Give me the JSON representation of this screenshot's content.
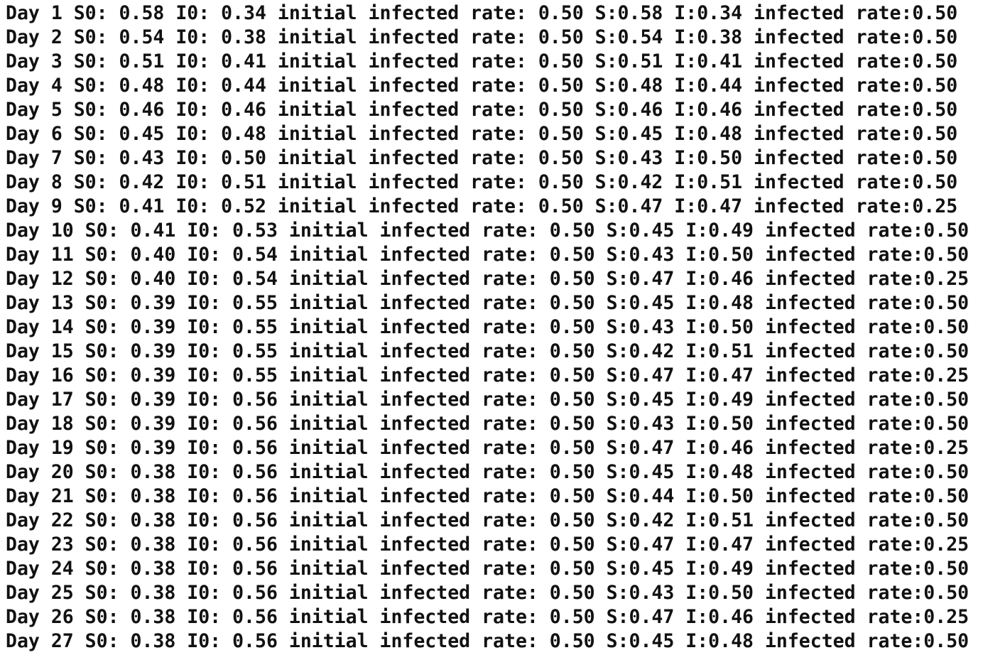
{
  "terminal": {
    "lines": [
      "Day 1 S0: 0.58 I0: 0.34 initial infected rate: 0.50 S:0.58 I:0.34 infected rate:0.50",
      "Day 2 S0: 0.54 I0: 0.38 initial infected rate: 0.50 S:0.54 I:0.38 infected rate:0.50",
      "Day 3 S0: 0.51 I0: 0.41 initial infected rate: 0.50 S:0.51 I:0.41 infected rate:0.50",
      "Day 4 S0: 0.48 I0: 0.44 initial infected rate: 0.50 S:0.48 I:0.44 infected rate:0.50",
      "Day 5 S0: 0.46 I0: 0.46 initial infected rate: 0.50 S:0.46 I:0.46 infected rate:0.50",
      "Day 6 S0: 0.45 I0: 0.48 initial infected rate: 0.50 S:0.45 I:0.48 infected rate:0.50",
      "Day 7 S0: 0.43 I0: 0.50 initial infected rate: 0.50 S:0.43 I:0.50 infected rate:0.50",
      "Day 8 S0: 0.42 I0: 0.51 initial infected rate: 0.50 S:0.42 I:0.51 infected rate:0.50",
      "Day 9 S0: 0.41 I0: 0.52 initial infected rate: 0.50 S:0.47 I:0.47 infected rate:0.25",
      "Day 10 S0: 0.41 I0: 0.53 initial infected rate: 0.50 S:0.45 I:0.49 infected rate:0.50",
      "Day 11 S0: 0.40 I0: 0.54 initial infected rate: 0.50 S:0.43 I:0.50 infected rate:0.50",
      "Day 12 S0: 0.40 I0: 0.54 initial infected rate: 0.50 S:0.47 I:0.46 infected rate:0.25",
      "Day 13 S0: 0.39 I0: 0.55 initial infected rate: 0.50 S:0.45 I:0.48 infected rate:0.50",
      "Day 14 S0: 0.39 I0: 0.55 initial infected rate: 0.50 S:0.43 I:0.50 infected rate:0.50",
      "Day 15 S0: 0.39 I0: 0.55 initial infected rate: 0.50 S:0.42 I:0.51 infected rate:0.50",
      "Day 16 S0: 0.39 I0: 0.55 initial infected rate: 0.50 S:0.47 I:0.47 infected rate:0.25",
      "Day 17 S0: 0.39 I0: 0.56 initial infected rate: 0.50 S:0.45 I:0.49 infected rate:0.50",
      "Day 18 S0: 0.39 I0: 0.56 initial infected rate: 0.50 S:0.43 I:0.50 infected rate:0.50",
      "Day 19 S0: 0.39 I0: 0.56 initial infected rate: 0.50 S:0.47 I:0.46 infected rate:0.25",
      "Day 20 S0: 0.38 I0: 0.56 initial infected rate: 0.50 S:0.45 I:0.48 infected rate:0.50",
      "Day 21 S0: 0.38 I0: 0.56 initial infected rate: 0.50 S:0.44 I:0.50 infected rate:0.50",
      "Day 22 S0: 0.38 I0: 0.56 initial infected rate: 0.50 S:0.42 I:0.51 infected rate:0.50",
      "Day 23 S0: 0.38 I0: 0.56 initial infected rate: 0.50 S:0.47 I:0.47 infected rate:0.25",
      "Day 24 S0: 0.38 I0: 0.56 initial infected rate: 0.50 S:0.45 I:0.49 infected rate:0.50",
      "Day 25 S0: 0.38 I0: 0.56 initial infected rate: 0.50 S:0.43 I:0.50 infected rate:0.50",
      "Day 26 S0: 0.38 I0: 0.56 initial infected rate: 0.50 S:0.47 I:0.46 infected rate:0.25",
      "Day 27 S0: 0.38 I0: 0.56 initial infected rate: 0.50 S:0.45 I:0.48 infected rate:0.50"
    ]
  }
}
